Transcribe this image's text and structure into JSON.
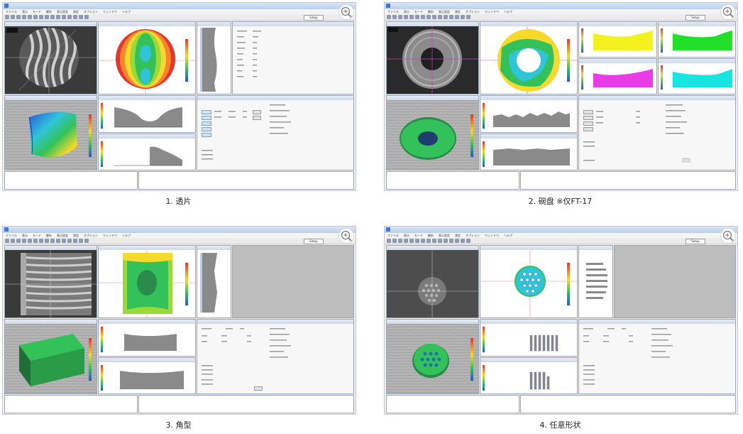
{
  "cards": [
    {
      "caption": "1. 透片"
    },
    {
      "caption": "2. 碗盘 ※仅FT-17"
    },
    {
      "caption": "3. 角型"
    },
    {
      "caption": "4. 任意形状"
    }
  ],
  "app": {
    "menu_items": [
      "ファイル",
      "表示",
      "モード",
      "解析",
      "表示設定",
      "測定",
      "オプション",
      "ウィンドウ",
      "ヘルプ"
    ],
    "display_select_value": "Setup"
  },
  "icons": {
    "zoom": "magnifier-plus-icon"
  },
  "colors": {
    "titlebar": "#c7d8ef",
    "contour_red": "#e8352a",
    "contour_green": "#33c25a",
    "contour_cyan": "#2fc5d8",
    "plot_gray": "#8a8a8a",
    "series_yellow": "#f4f21e",
    "series_green": "#22e02a",
    "series_magenta": "#e93ce6",
    "series_cyan": "#18e4e2"
  }
}
